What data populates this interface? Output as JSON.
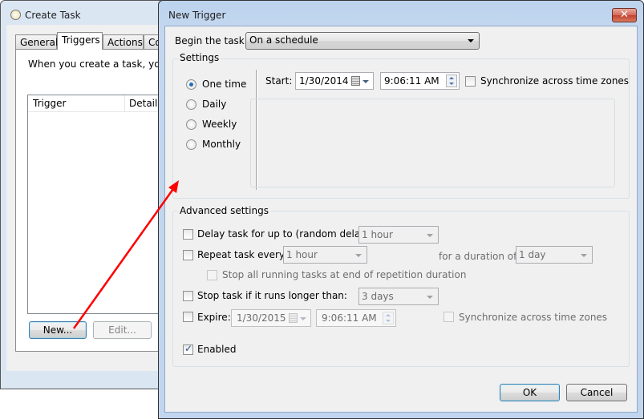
{
  "create_task": {
    "title": "Create Task",
    "tabs": [
      {
        "label": "General"
      },
      {
        "label": "Triggers",
        "active": true
      },
      {
        "label": "Actions"
      },
      {
        "label": "Co"
      }
    ],
    "description": "When you create a task, you ca",
    "columns": [
      "Trigger",
      "Details"
    ],
    "buttons": {
      "new": "New...",
      "edit": "Edit..."
    }
  },
  "new_trigger": {
    "title": "New Trigger",
    "close_icon": "close-icon",
    "begin_label": "Begin the task:",
    "begin_value": "On a schedule",
    "settings": {
      "label": "Settings",
      "schedule_options": [
        {
          "label": "One time",
          "selected": true
        },
        {
          "label": "Daily"
        },
        {
          "label": "Weekly"
        },
        {
          "label": "Monthly"
        }
      ],
      "start_label": "Start:",
      "start_date": "1/30/2014",
      "start_time": "9:06:11 AM",
      "sync_label": "Synchronize across time zones",
      "sync_checked": false
    },
    "advanced": {
      "label": "Advanced settings",
      "delay_label": "Delay task for up to (random delay):",
      "delay_value": "1 hour",
      "repeat_label": "Repeat task every:",
      "repeat_value": "1 hour",
      "duration_label": "for a duration of:",
      "duration_value": "1 day",
      "stop_all_label": "Stop all running tasks at end of repetition duration",
      "stop_longer_label": "Stop task if it runs longer than:",
      "stop_longer_value": "3 days",
      "expire_label": "Expire:",
      "expire_date": "1/30/2015",
      "expire_time": "9:06:11 AM",
      "expire_sync_label": "Synchronize across time zones",
      "enabled_label": "Enabled",
      "enabled_checked": true
    },
    "buttons": {
      "ok": "OK",
      "cancel": "Cancel"
    }
  },
  "annotation": {
    "color": "#ff0000"
  }
}
